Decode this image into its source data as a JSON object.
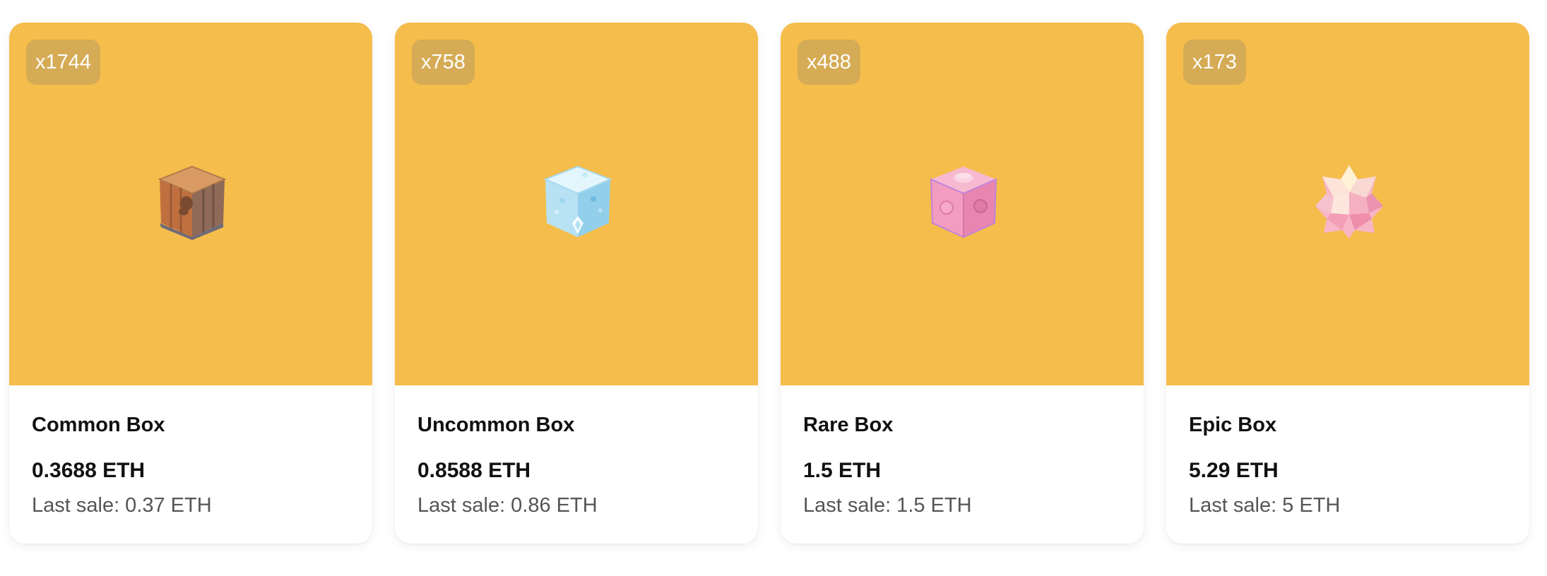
{
  "colors": {
    "media_background": "#f5bd4b",
    "badge_text": "#ffffff",
    "name_text": "#111111",
    "secondary_text": "#555555"
  },
  "cards": [
    {
      "count": "x1744",
      "name": "Common Box",
      "price": "0.3688 ETH",
      "last_sale": "Last sale: 0.37 ETH",
      "icon": "wooden-box-icon"
    },
    {
      "count": "x758",
      "name": "Uncommon Box",
      "price": "0.8588 ETH",
      "last_sale": "Last sale: 0.86 ETH",
      "icon": "ice-box-icon"
    },
    {
      "count": "x488",
      "name": "Rare Box",
      "price": "1.5 ETH",
      "last_sale": "Last sale: 1.5 ETH",
      "icon": "pink-box-icon"
    },
    {
      "count": "x173",
      "name": "Epic Box",
      "price": "5.29 ETH",
      "last_sale": "Last sale: 5 ETH",
      "icon": "crystal-box-icon"
    }
  ]
}
